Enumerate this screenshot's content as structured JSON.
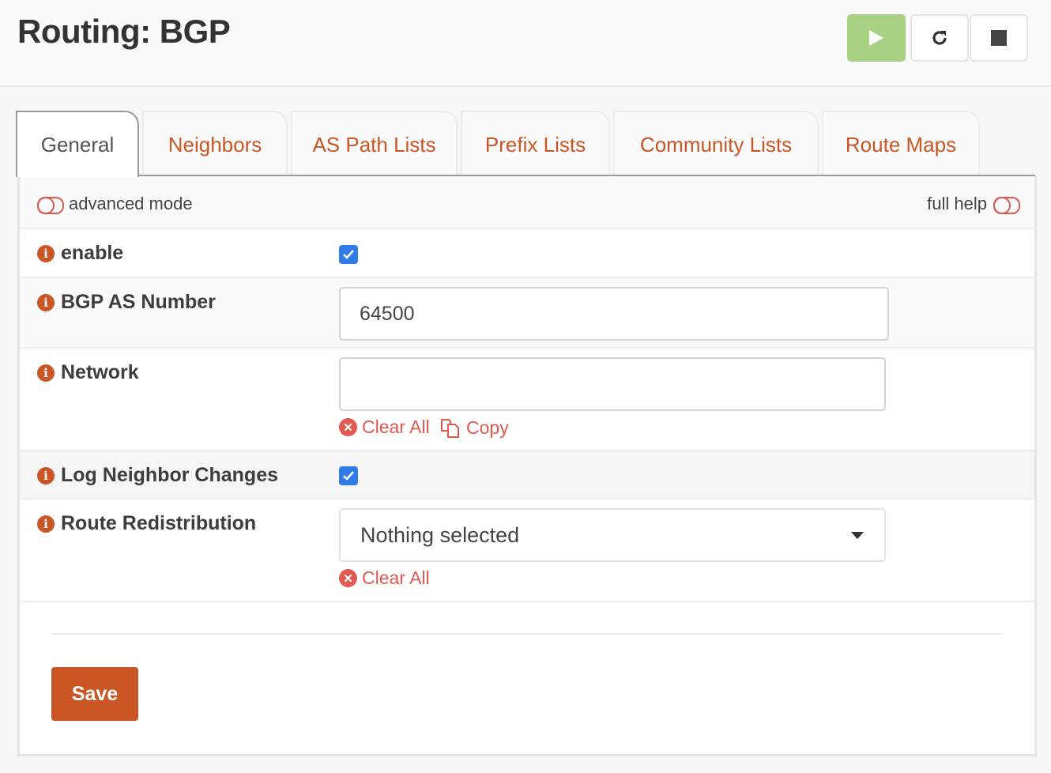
{
  "header": {
    "title": "Routing: BGP",
    "service_buttons": [
      {
        "name": "start",
        "icon": "play-icon",
        "color": "#a8d083"
      },
      {
        "name": "restart",
        "icon": "restart-icon"
      },
      {
        "name": "stop",
        "icon": "stop-icon"
      }
    ]
  },
  "tabs": [
    {
      "label": "General",
      "active": true
    },
    {
      "label": "Neighbors",
      "active": false
    },
    {
      "label": "AS Path Lists",
      "active": false
    },
    {
      "label": "Prefix Lists",
      "active": false
    },
    {
      "label": "Community Lists",
      "active": false
    },
    {
      "label": "Route Maps",
      "active": false
    }
  ],
  "toolbar": {
    "advanced_mode_label": "advanced mode",
    "full_help_label": "full help"
  },
  "form": {
    "enable": {
      "label": "enable",
      "checked": true
    },
    "as_number": {
      "label": "BGP AS Number",
      "value": "64500"
    },
    "network": {
      "label": "Network",
      "value": "",
      "clear_label": "Clear All",
      "copy_label": "Copy"
    },
    "log_neighbor_changes": {
      "label": "Log Neighbor Changes",
      "checked": true
    },
    "route_redistribution": {
      "label": "Route Redistribution",
      "selected": "Nothing selected",
      "clear_label": "Clear All"
    }
  },
  "actions": {
    "save_label": "Save"
  },
  "colors": {
    "accent": "#c95624",
    "link_red": "#e05a52",
    "checkbox_blue": "#2f7be8",
    "start_green": "#a8d083"
  }
}
